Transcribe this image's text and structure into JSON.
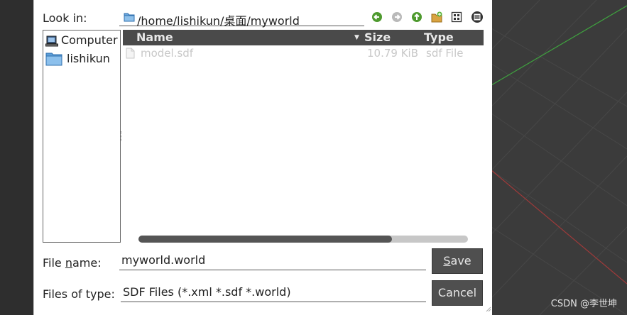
{
  "dialog": {
    "look_in_label": "Look in:",
    "path": "/home/lishikun/桌面/myworld",
    "toolbar": {
      "back_icon": "back-arrow-icon",
      "forward_icon": "forward-arrow-icon",
      "up_icon": "up-arrow-icon",
      "new_folder_icon": "new-folder-icon",
      "list_view_icon": "list-view-icon",
      "detail_view_icon": "detail-view-icon"
    },
    "sidebar": {
      "items": [
        {
          "label": "Computer",
          "icon": "computer-icon"
        },
        {
          "label": "lishikun",
          "icon": "folder-icon"
        }
      ]
    },
    "file_list": {
      "columns": [
        "Name",
        "Size",
        "Type"
      ],
      "rows": [
        {
          "name": "model.sdf",
          "size": "10.79 KiB",
          "type": "sdf File"
        }
      ],
      "scroll_fraction": 0.77
    },
    "file_name_label": "File name:",
    "file_name_value": "myworld.world",
    "file_type_label": "Files of type:",
    "file_type_value": "SDF Files (*.xml *.sdf *.world)",
    "save_label": "Save",
    "cancel_label": "Cancel"
  },
  "watermark": "CSDN @李世坤"
}
